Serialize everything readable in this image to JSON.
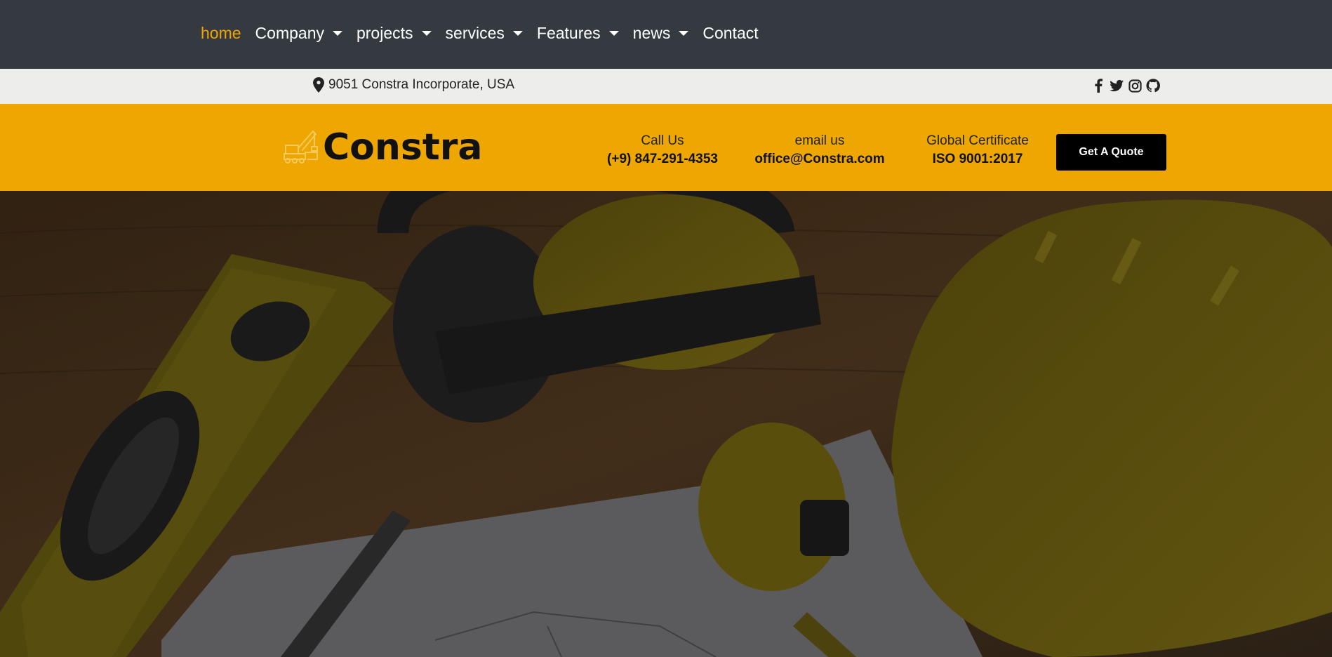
{
  "nav": {
    "items": [
      {
        "label": "home",
        "dropdown": false,
        "active": true
      },
      {
        "label": "Company",
        "dropdown": true,
        "active": false
      },
      {
        "label": "projects",
        "dropdown": true,
        "active": false
      },
      {
        "label": "services",
        "dropdown": true,
        "active": false
      },
      {
        "label": "Features",
        "dropdown": true,
        "active": false
      },
      {
        "label": "news",
        "dropdown": true,
        "active": false
      },
      {
        "label": "Contact",
        "dropdown": false,
        "active": false
      }
    ]
  },
  "topbar": {
    "address": "9051 Constra Incorporate, USA",
    "address_icon": "map-pin-icon",
    "social_icons": [
      "facebook-icon",
      "twitter-icon",
      "instagram-icon",
      "github-icon"
    ]
  },
  "header": {
    "brand": "Constra",
    "call_label": "Call Us",
    "call_value": "(+9) 847-291-4353",
    "email_label": "email us",
    "email_value": "office@Constra.com",
    "cert_label": "Global Certificate",
    "cert_value": "ISO 9001:2017",
    "quote_button": "Get A Quote"
  },
  "colors": {
    "nav_bg": "#343a40",
    "accent": "#f0a500",
    "brand_bar": "#eea700",
    "info_bar": "#ededeb"
  }
}
